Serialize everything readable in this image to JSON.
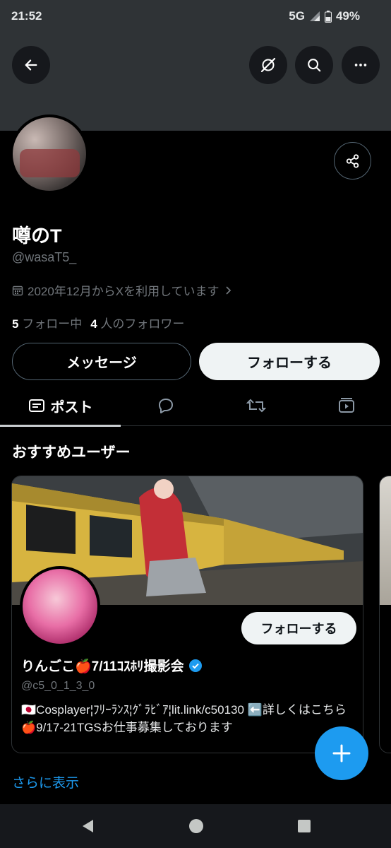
{
  "status_bar": {
    "time": "21:52",
    "network": "5G",
    "battery": "49%"
  },
  "header_actions": {
    "back_icon": "arrow-left-icon",
    "grok_icon": "grok-icon",
    "search_icon": "search-icon",
    "more_icon": "more-horizontal-icon"
  },
  "profile": {
    "name": "噂のT",
    "handle": "@wasaT5_",
    "joined": "2020年12月からXを利用しています",
    "following_count": "5",
    "following_label": "フォロー中",
    "followers_count": "4",
    "followers_label": "人のフォロワー"
  },
  "actions": {
    "message_label": "メッセージ",
    "follow_label": "フォローする"
  },
  "tabs": {
    "posts_label": "ポスト"
  },
  "recommended": {
    "title": "おすすめユーザー",
    "user": {
      "name": "りんごこ🍎7/11ｺｽﾎﾘ撮影会",
      "handle": "@c5_0_1_3_0",
      "bio": "🇯🇵Cosplayer¦ﾌﾘｰﾗﾝｽ¦ｸﾞﾗﾋﾞｱ¦lit.link/c50130 ⬅️詳しくはこちら🍎9/17-21TGSお仕事募集しております",
      "follow_label": "フォローする",
      "verified": true
    },
    "show_more": "さらに表示"
  },
  "colors": {
    "accent": "#1d9bf0",
    "background": "#000000",
    "banner": "#2f3336"
  }
}
